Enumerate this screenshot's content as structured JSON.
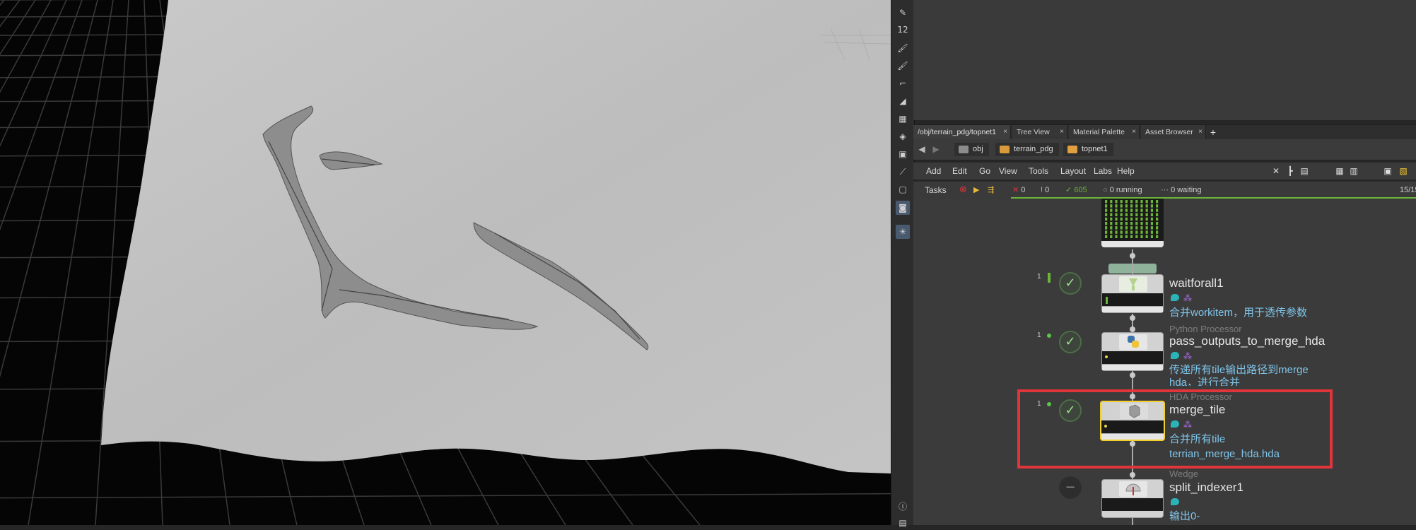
{
  "viewport": {},
  "shelf": {
    "tools": [
      {
        "icon": "pen-icon",
        "glyph": "✎"
      },
      {
        "icon": "number-tool-icon",
        "glyph": "12"
      },
      {
        "icon": "brush-icon",
        "glyph": "🖌"
      },
      {
        "icon": "brush-number-icon",
        "glyph": "🖌"
      },
      {
        "icon": "corner-tool-icon",
        "glyph": "⌐"
      },
      {
        "icon": "sculpt-icon",
        "glyph": "◢"
      },
      {
        "icon": "grid-tool-icon",
        "glyph": "▦"
      },
      {
        "icon": "layers-icon",
        "glyph": "◈"
      },
      {
        "icon": "mesh-icon",
        "glyph": "▣"
      },
      {
        "icon": "vector-tool-icon",
        "glyph": "⟋"
      },
      {
        "icon": "square-tool-icon",
        "glyph": "▢"
      },
      {
        "icon": "camera-tool-icon",
        "glyph": "◙"
      },
      {
        "icon": "light-tool-icon",
        "glyph": "☀"
      },
      {
        "icon": "info-icon",
        "glyph": "ⓘ"
      },
      {
        "icon": "display-options-icon",
        "glyph": "▤"
      }
    ]
  },
  "tabs": [
    {
      "label": "/obj/terrain_pdg/topnet1",
      "close": "×"
    },
    {
      "label": "Tree View",
      "close": "×"
    },
    {
      "label": "Material Palette",
      "close": "×"
    },
    {
      "label": "Asset Browser",
      "close": "×"
    }
  ],
  "tab_add": "+",
  "path": {
    "back": "◀",
    "forward": "▶",
    "crumbs": [
      "obj",
      "terrain_pdg",
      "topnet1"
    ]
  },
  "menu": {
    "items": [
      "Add",
      "Edit",
      "Go",
      "View",
      "Tools",
      "Layout",
      "Labs",
      "Help"
    ],
    "toolbar_icons": [
      "wrench-icon",
      "tree-icon",
      "list-icon",
      "grid-view-icon",
      "table-view-icon",
      "panel-icon",
      "notes-icon"
    ]
  },
  "tasks": {
    "label": "Tasks",
    "failed": "0",
    "warnings": "0",
    "complete": "605",
    "running": "0 running",
    "waiting": "0 waiting",
    "progress": "15/15",
    "colors": {
      "complete": "#6db53a",
      "failed": "#e0353b"
    }
  },
  "nodes": [
    {
      "id": "waitforall1",
      "count": "1",
      "type": "",
      "name": "waitforall1",
      "comment": [
        "合并workitem，用于透传参数"
      ]
    },
    {
      "id": "pass_outputs",
      "count": "1",
      "type": "Python Processor",
      "name": "pass_outputs_to_merge_hda",
      "comment": [
        "传递所有tile输出路径到merge",
        "hda，进行合并"
      ]
    },
    {
      "id": "merge_tile",
      "count": "1",
      "type": "HDA Processor",
      "name": "merge_tile",
      "comment": [
        "合并所有tile",
        "terrian_merge_hda.hda"
      ]
    },
    {
      "id": "split_indexer1",
      "count": "",
      "type": "Wedge",
      "name": "split_indexer1",
      "comment": [
        "输出0-"
      ]
    }
  ],
  "highlight_color": "#e0353b",
  "selected_color": "#f2cf2c"
}
